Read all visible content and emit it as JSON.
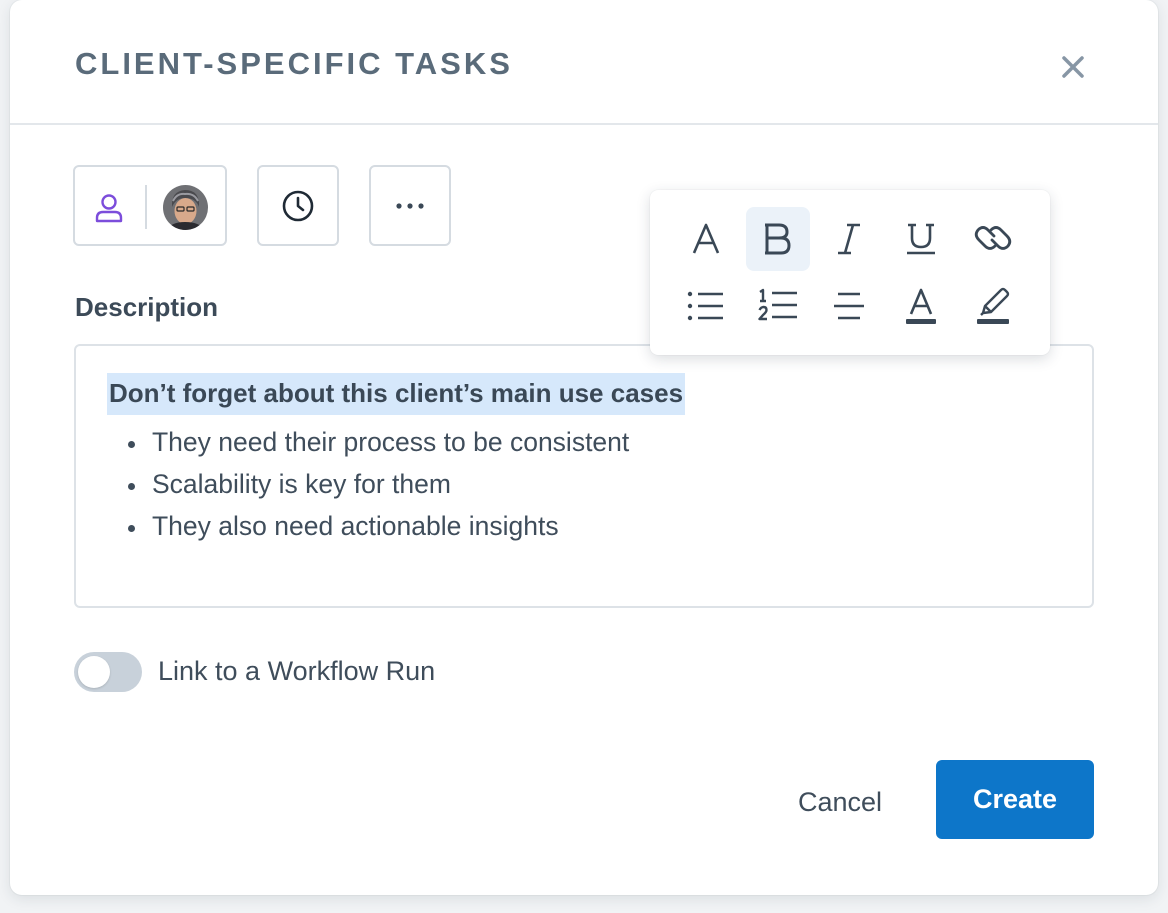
{
  "modal": {
    "title": "CLIENT-SPECIFIC TASKS",
    "close_icon": "close-icon"
  },
  "chips": {
    "assignee_icon": "user-icon",
    "clock_icon": "clock-icon",
    "more_icon": "more-horizontal-icon"
  },
  "description": {
    "label": "Description",
    "heading": "Don’t forget about this client’s main use cases",
    "bullets": [
      "They need their process to be consistent",
      "Scalability is key for them",
      "They also need actionable insights"
    ]
  },
  "formatting_toolbar": {
    "row1": [
      "font-icon",
      "bold-icon",
      "italic-icon",
      "underline-icon",
      "link-icon"
    ],
    "row2": [
      "bulleted-list-icon",
      "numbered-list-icon",
      "align-center-icon",
      "text-color-icon",
      "highlighter-icon"
    ],
    "active": "bold-icon"
  },
  "workflow_toggle": {
    "label": "Link to a Workflow Run",
    "enabled": false
  },
  "footer": {
    "cancel_label": "Cancel",
    "create_label": "Create"
  },
  "colors": {
    "primary": "#0d76c9",
    "title": "#5a6b7a",
    "text": "#3f4d5b",
    "highlight": "#d6e8fb",
    "user_icon": "#7c4ddb"
  }
}
